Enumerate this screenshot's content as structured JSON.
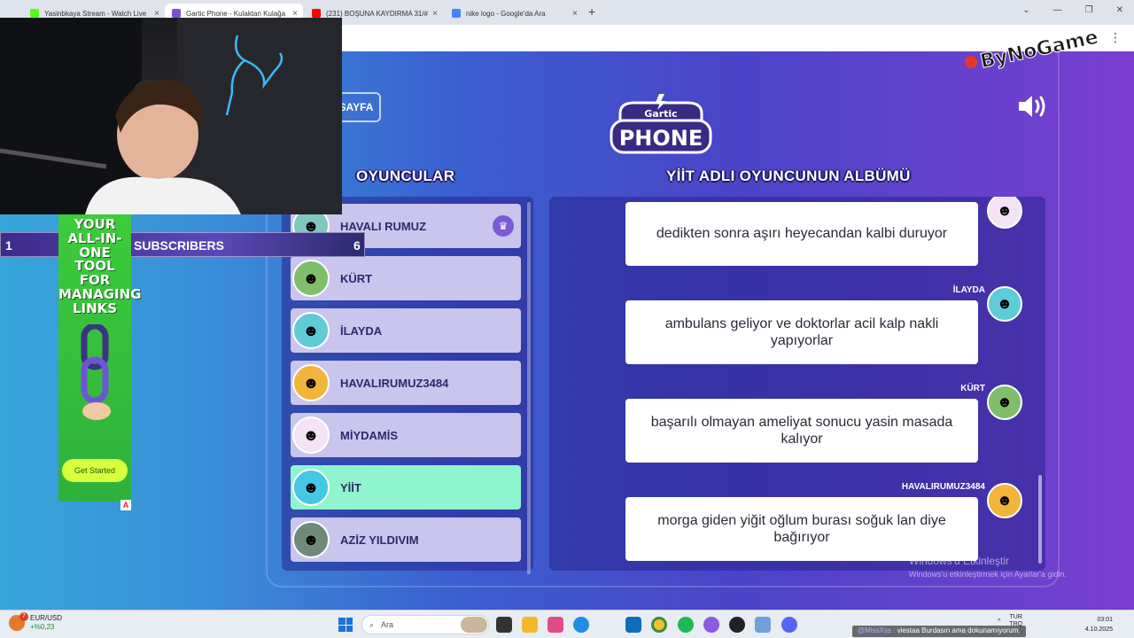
{
  "browser": {
    "tabs": [
      {
        "label": "Yasinbkaya Stream - Watch Live",
        "favicon_color": "#53fc18"
      },
      {
        "label": "Gartic Phone - Kulaktan Kulağa",
        "favicon_color": "#7a4fd8"
      },
      {
        "label": "(231) BOŞUNA KAYDIRMA 31/#",
        "favicon_color": "#ff0000"
      },
      {
        "label": "nike logo - Google'da Ara",
        "favicon_color": "#4285f4"
      }
    ],
    "new_tab": "+",
    "close_glyph": "×",
    "window_controls": [
      "⌄",
      "—",
      "❐",
      "✕"
    ],
    "menu_glyph": "⋮"
  },
  "game": {
    "back_button": "SAYFA",
    "logo_top": "Gartic",
    "logo_bottom": "PHONE",
    "players_title": "OYUNCULAR",
    "album_title": "YİİT ADLI OYUNCUNUN ALBÜMÜ",
    "players": [
      {
        "name": "HAVALI RUMUZ",
        "avatar_color": "#7ec8c0",
        "emoji": "☻",
        "host": true,
        "active": false
      },
      {
        "name": "KÜRT",
        "avatar_color": "#7fbf6a",
        "emoji": "☻",
        "host": false,
        "active": false
      },
      {
        "name": "İLAYDA",
        "avatar_color": "#5ecbd6",
        "emoji": "☻",
        "host": false,
        "active": false
      },
      {
        "name": "HAVALIRUMUZ3484",
        "avatar_color": "#f2b43a",
        "emoji": "☻",
        "host": false,
        "active": false
      },
      {
        "name": "MİYDAMİS",
        "avatar_color": "#f4e3f4",
        "emoji": "☻",
        "host": false,
        "active": false
      },
      {
        "name": "YİİT",
        "avatar_color": "#45c7e6",
        "emoji": "☻",
        "host": false,
        "active": true
      },
      {
        "name": "AZİZ YILDIVIM",
        "avatar_color": "#6f8a79",
        "emoji": "☻",
        "host": false,
        "active": false
      }
    ],
    "host_icon": "♛",
    "messages": [
      {
        "author": "",
        "text": "dedikten sonra aşırı heyecandan kalbi duruyor",
        "avatar_color": "#f4e3f4"
      },
      {
        "author": "İLAYDA",
        "text": "ambulans geliyor ve doktorlar acil kalp nakli yapıyorlar",
        "avatar_color": "#5ecbd6"
      },
      {
        "author": "KÜRT",
        "text": "başarılı olmayan ameliyat sonucu yasin masada kalıyor",
        "avatar_color": "#7fbf6a"
      },
      {
        "author": "HAVALIRUMUZ3484",
        "text": "morga giden yiğit oğlum burası soğuk lan diye bağırıyor",
        "avatar_color": "#f2b43a"
      }
    ]
  },
  "windows_activation": {
    "line1": "Windows'u Etkinleştir",
    "line2": "Windows'u etkinleştirmek için Ayarlar'a gidin."
  },
  "overlay": {
    "sub_count_left": "1",
    "sub_label": "SUBSCRIBERS",
    "sub_count_right": "6",
    "ad_title": "YOUR ALL-IN-ONE TOOL FOR MANAGING LINKS",
    "ad_cta": "Get Started",
    "ad_choice": "A",
    "channel_logo_text": "ByNoGame"
  },
  "taskbar": {
    "weather_badge": "7",
    "ticker_name": "EUR/USD",
    "ticker_change": "+%0,23",
    "search_placeholder": "Ara",
    "tray_lang_top": "TUR",
    "tray_lang_bottom": "TRQ",
    "time": "03:01",
    "date": "4.10.2025",
    "tray_chevron": "^"
  },
  "chat": {
    "user": "@MissXss :",
    "message": "viestaa Burdasın ama dokunamıyorum."
  }
}
